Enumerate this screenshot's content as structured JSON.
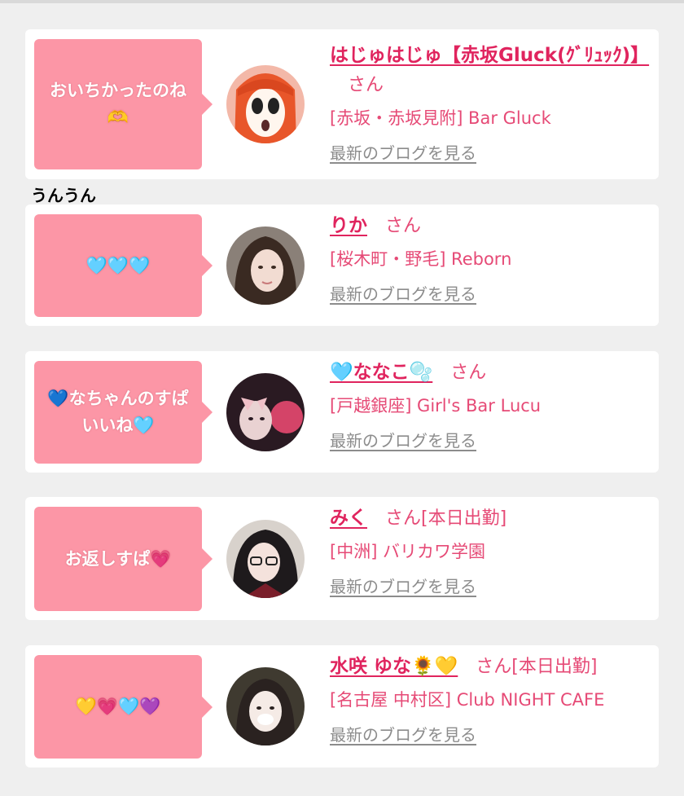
{
  "note": "うんうん",
  "blog_link_label": "最新のブログを見る",
  "posts": [
    {
      "bubble": "おいちかったのね🫶",
      "name": "はじゅはじゅ【赤坂Gluck(ｸﾞﾘｭｯｸ)】",
      "suffix": "さん",
      "shop": "[赤坂・赤坂見附] Bar Gluck"
    },
    {
      "bubble": "🩵🩵🩵",
      "name": "りか",
      "suffix": "さん",
      "shop": "[桜木町・野毛] Reborn"
    },
    {
      "bubble": "💙なちゃんのすぱいいね🩵",
      "name": "🩵ななこ🫧",
      "suffix": "さん",
      "shop": "[戸越銀座] Girl's Bar Lucu"
    },
    {
      "bubble": "お返しすぱ💗",
      "name": "みく",
      "suffix": "さん[本日出勤]",
      "shop": "[中洲] バリカワ学園"
    },
    {
      "bubble": "💛💗🩵💜",
      "name": "水咲 ゆな🌻💛",
      "suffix": "さん[本日出勤]",
      "shop": "[名古屋 中村区] Club NIGHT CAFE"
    }
  ]
}
